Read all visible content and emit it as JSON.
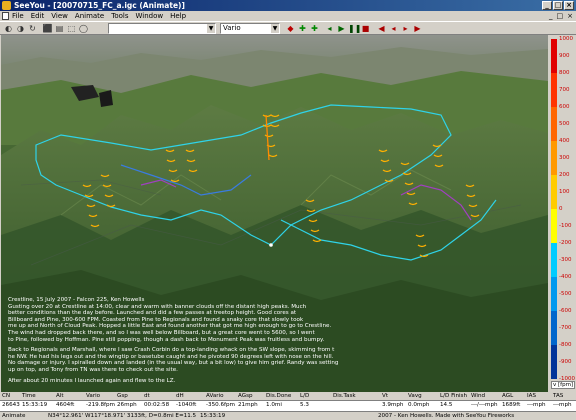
{
  "window": {
    "title": "SeeYou - [20070715_FC_a.igc (Animate)]",
    "min_glyph": "_",
    "max_glyph": "□",
    "close_glyph": "×"
  },
  "menu": {
    "items": [
      "File",
      "Edit",
      "View",
      "Animate",
      "Tools",
      "Window",
      "Help"
    ],
    "right_glyphs": [
      "_",
      "□",
      "×"
    ]
  },
  "toolbar": {
    "left_glyphs": [
      "◐",
      "◑",
      "↻",
      "⬛",
      "▤",
      "⬚",
      "◯"
    ],
    "variable_combo": "Vario",
    "speed_combo": "",
    "right_glyphs": [
      "◂",
      "▶",
      "❚❚",
      "■",
      "◀",
      "◂",
      "▸",
      "▶"
    ]
  },
  "map": {
    "story_paragraphs": [
      [
        "Crestline, 15 July 2007 - Falcon 225, Ken Howells",
        "Gusting over 20 at Crestline at 14:00, clear and warm with banner clouds off the distant high peaks. Much",
        "better conditions than the day before. Launched and did a few passes at treetop height. Good cores at",
        "Billboard and Pine, 300-600 FPM. Coasted from Pine to Regionals and found a snaky core that slowly took",
        "me up and North of Cloud Peak. Hopped a little East and found another that got me high enough to go to Crestline.",
        "The wind had dropped back there, and so I was well below Billboard, but a great core went to 5600, so I went",
        "to Pine, followed by Hoffman. Pine still popping, though a dash back to Monument Peak was fruitless and bumpy."
      ],
      [
        "Back to Regionals and Marshall, where I saw Crash Corbin do a top-landing whack on the SW slope, skimming from t",
        "he NW. He had his legs out and the wingtip or basetube caught and he pivoted 90 degrees left with nose on the hill.",
        "No damage or injury. I spiralled down and landed (in the usual way, but a bit low) to give him grief. Randy was setting",
        "up on top, and Tony from TN was there to check out the site."
      ],
      [
        "After about 20 minutes I launched again and flew to the LZ."
      ]
    ]
  },
  "vario_scale": {
    "ticks": [
      "1000",
      "900",
      "800",
      "700",
      "600",
      "500",
      "400",
      "300",
      "200",
      "100",
      "0",
      "-100",
      "-200",
      "-300",
      "-400",
      "-500",
      "-600",
      "-700",
      "-800",
      "-900",
      "-1000"
    ],
    "unit": "v [fpm]",
    "colors": [
      "#e00000",
      "#ff3300",
      "#ff6600",
      "#ff9900",
      "#ffcc00",
      "#ffff00",
      "#00ccff",
      "#0099ee",
      "#0066cc",
      "#003399"
    ]
  },
  "status_grid": {
    "headers": [
      "CN",
      "Time",
      "Alt",
      "Vario",
      "Gsp",
      "dt",
      "dH",
      "AVario",
      "AGsp",
      "Dis.Done",
      "L/D",
      "Dis.Task",
      "Vt",
      "Vavg",
      "L/D Finish",
      "Wind",
      "AGL",
      "IAS",
      "TAS"
    ],
    "values": [
      "26643",
      "15:33:19",
      "4604ft",
      "-219.8fpm",
      "26mph",
      "00:02:58",
      "-1040ft",
      "-350.6fpm",
      "21mph",
      "1.0mi",
      "5.3",
      "",
      "3.9mph",
      "0.0mph",
      "14.5",
      "---/---mph",
      "1689ft",
      "---mph",
      "---mph"
    ]
  },
  "status_bar": {
    "mode": "Animate",
    "coords": "N34°12.961' W117°18.971' 3133ft, D=0.8mi E=11.5",
    "time": "15:33:19",
    "copyright": "2007 - Ken Howells. Made with SeeYou Fireworks"
  }
}
